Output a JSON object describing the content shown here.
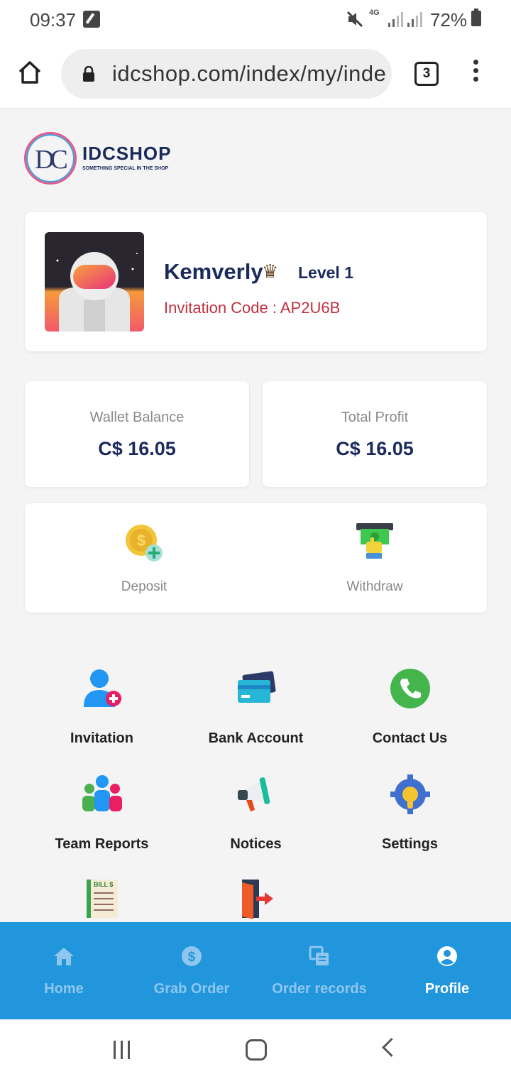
{
  "status_bar": {
    "time": "09:37",
    "network": "4G",
    "battery": "72%",
    "icons": [
      "edit-icon",
      "mute-icon",
      "signal-icon",
      "battery-icon"
    ]
  },
  "browser": {
    "url": "idcshop.com/index/my/inde",
    "tab_count": "3",
    "icons": [
      "home-icon",
      "lock-icon",
      "tabs-icon",
      "more-vert-icon"
    ]
  },
  "logo": {
    "monogram": "DC",
    "name": "IDCSHOP",
    "tagline": "SOMETHING SPECIAL IN THE SHOP"
  },
  "profile": {
    "username": "Kemverly",
    "crown_icon": "♛",
    "level": "Level 1",
    "invitation_code": "Invitation Code : AP2U6B"
  },
  "stats": {
    "wallet_label": "Wallet Balance",
    "wallet_value": "C$ 16.05",
    "profit_label": "Total Profit",
    "profit_value": "C$ 16.05"
  },
  "actions": {
    "deposit": "Deposit",
    "withdraw": "Withdraw"
  },
  "menu": {
    "invitation": "Invitation",
    "bank_account": "Bank Account",
    "contact_us": "Contact Us",
    "team_reports": "Team Reports",
    "notices": "Notices",
    "settings": "Settings",
    "bill_text": "BILL $"
  },
  "bottom_nav": {
    "home": "Home",
    "grab_order": "Grab Order",
    "order_records": "Order records",
    "profile": "Profile",
    "active": "Profile"
  },
  "colors": {
    "primary_navy": "#1a2b5c",
    "nav_blue": "#2196dc",
    "invite_red": "#c0303f"
  }
}
